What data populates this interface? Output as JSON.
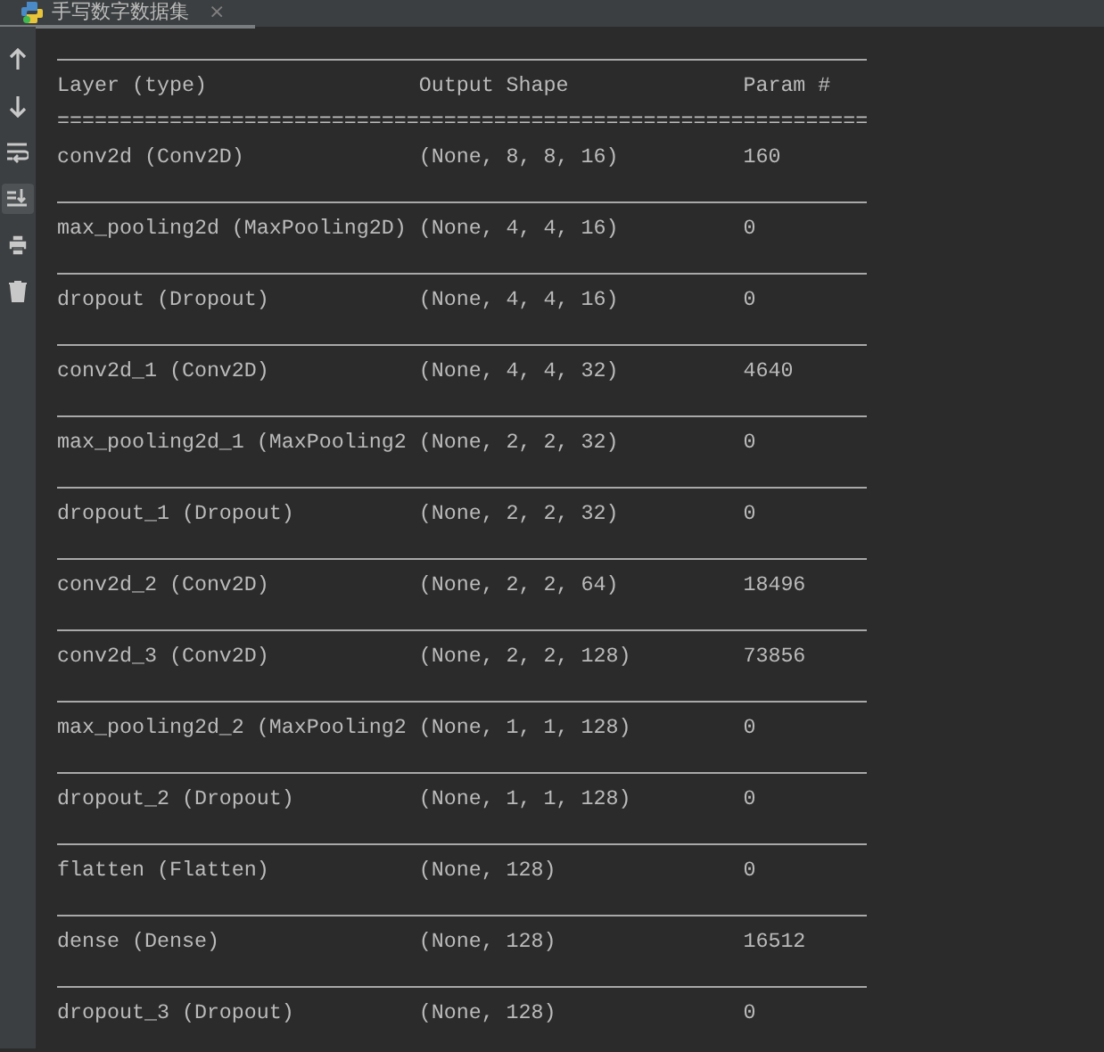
{
  "tab": {
    "title": "手写数字数据集",
    "close": "×"
  },
  "toolbar": [
    {
      "kind": "up",
      "on": false
    },
    {
      "kind": "down",
      "on": false
    },
    {
      "kind": "wrap",
      "on": false
    },
    {
      "kind": "scroll-end",
      "on": true
    },
    {
      "kind": "print",
      "on": false
    },
    {
      "kind": "trash",
      "on": false
    }
  ],
  "summary": {
    "header": [
      "Layer (type)",
      "Output Shape",
      "Param #"
    ],
    "double_rule": "=================================================================",
    "layers": [
      {
        "layer": "conv2d (Conv2D)",
        "output_shape": "(None, 8, 8, 16)",
        "params": "160"
      },
      {
        "layer": "max_pooling2d (MaxPooling2D)",
        "output_shape": "(None, 4, 4, 16)",
        "params": "0"
      },
      {
        "layer": "dropout (Dropout)",
        "output_shape": "(None, 4, 4, 16)",
        "params": "0"
      },
      {
        "layer": "conv2d_1 (Conv2D)",
        "output_shape": "(None, 4, 4, 32)",
        "params": "4640"
      },
      {
        "layer": "max_pooling2d_1 (MaxPooling2",
        "output_shape": "(None, 2, 2, 32)",
        "params": "0"
      },
      {
        "layer": "dropout_1 (Dropout)",
        "output_shape": "(None, 2, 2, 32)",
        "params": "0"
      },
      {
        "layer": "conv2d_2 (Conv2D)",
        "output_shape": "(None, 2, 2, 64)",
        "params": "18496"
      },
      {
        "layer": "conv2d_3 (Conv2D)",
        "output_shape": "(None, 2, 2, 128)",
        "params": "73856"
      },
      {
        "layer": "max_pooling2d_2 (MaxPooling2",
        "output_shape": "(None, 1, 1, 128)",
        "params": "0"
      },
      {
        "layer": "dropout_2 (Dropout)",
        "output_shape": "(None, 1, 1, 128)",
        "params": "0"
      },
      {
        "layer": "flatten (Flatten)",
        "output_shape": "(None, 128)",
        "params": "0"
      },
      {
        "layer": "dense (Dense)",
        "output_shape": "(None, 128)",
        "params": "16512"
      },
      {
        "layer": "dropout_3 (Dropout)",
        "output_shape": "(None, 128)",
        "params": "0"
      }
    ]
  }
}
